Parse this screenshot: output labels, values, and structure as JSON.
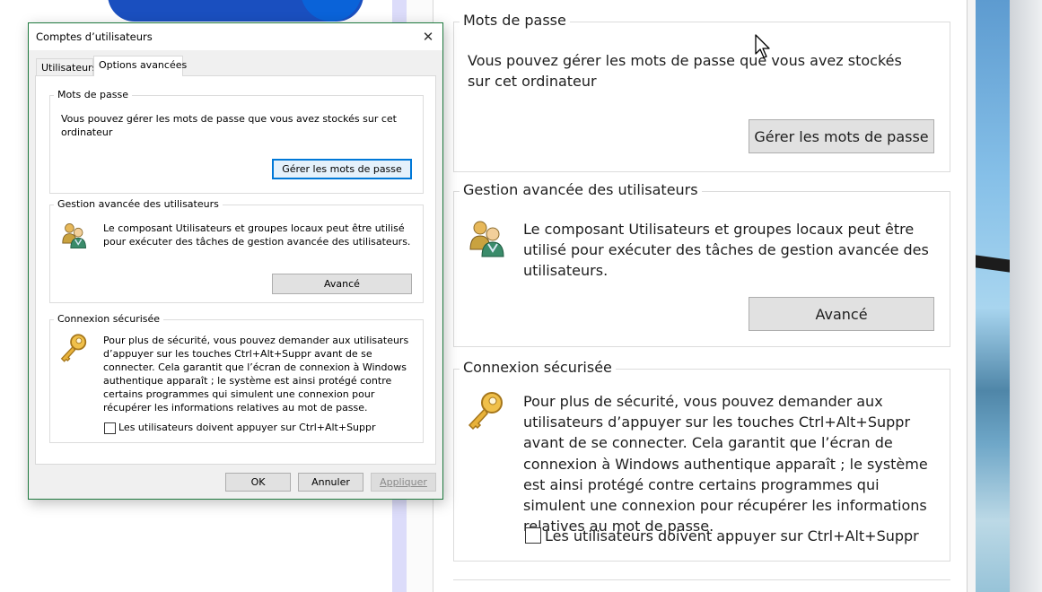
{
  "dialog": {
    "title": "Comptes d’utilisateurs",
    "close_glyph": "✕",
    "tabs": [
      {
        "label": "Utilisateurs",
        "active": false
      },
      {
        "label": "Options avancées",
        "active": true
      }
    ],
    "passwords": {
      "legend": "Mots de passe",
      "text": "Vous pouvez gérer les mots de passe que vous avez stockés sur cet ordinateur",
      "button": "Gérer les mots de passe"
    },
    "advanced": {
      "legend": "Gestion avancée des utilisateurs",
      "text": "Le composant Utilisateurs et groupes locaux peut être utilisé pour exécuter des tâches de gestion avancée des utilisateurs.",
      "button": "Avancé"
    },
    "secure": {
      "legend": "Connexion sécurisée",
      "text": "Pour plus de sécurité, vous pouvez demander aux utilisateurs d’appuyer sur les touches Ctrl+Alt+Suppr avant de se connecter. Cela garantit que l’écran de connexion à Windows authentique apparaît ; le système est ainsi protégé contre certains programmes qui simulent une connexion pour récupérer les informations relatives au mot de passe.",
      "checkbox": "Les utilisateurs doivent appuyer sur Ctrl+Alt+Suppr",
      "checked": false
    },
    "buttons": {
      "ok": "OK",
      "cancel": "Annuler",
      "apply": "Appliquer"
    }
  },
  "zoomed": {
    "passwords": {
      "legend": "Mots de passe",
      "text": "Vous pouvez gérer les mots de passe que vous avez stockés sur cet ordinateur",
      "button": "Gérer les mots de passe"
    },
    "advanced": {
      "legend": "Gestion avancée des utilisateurs",
      "text": "Le composant Utilisateurs et groupes locaux peut être utilisé pour exécuter des tâches de gestion avancée des utilisateurs.",
      "button": "Avancé"
    },
    "secure": {
      "legend": "Connexion sécurisée",
      "text": "Pour plus de sécurité, vous pouvez demander aux utilisateurs d’appuyer sur les touches Ctrl+Alt+Suppr avant de se connecter. Cela garantit que l’écran de connexion à Windows authentique apparaît ; le système est ainsi protégé contre certains programmes qui simulent une connexion pour récupérer les informations relatives au mot de passe.",
      "checkbox": "Les utilisateurs doivent appuyer sur Ctrl+Alt+Suppr",
      "checked": false
    }
  },
  "icons": {
    "users": "users-group-icon",
    "key": "key-icon",
    "close": "close-icon",
    "cursor": "mouse-cursor-icon"
  },
  "colors": {
    "accent": "#0078d7",
    "dialog_border": "#1f7a3f",
    "button_face": "#e1e1e1",
    "key_gold": "#e8b23a",
    "desktop_blue": "#1a4fbf"
  }
}
